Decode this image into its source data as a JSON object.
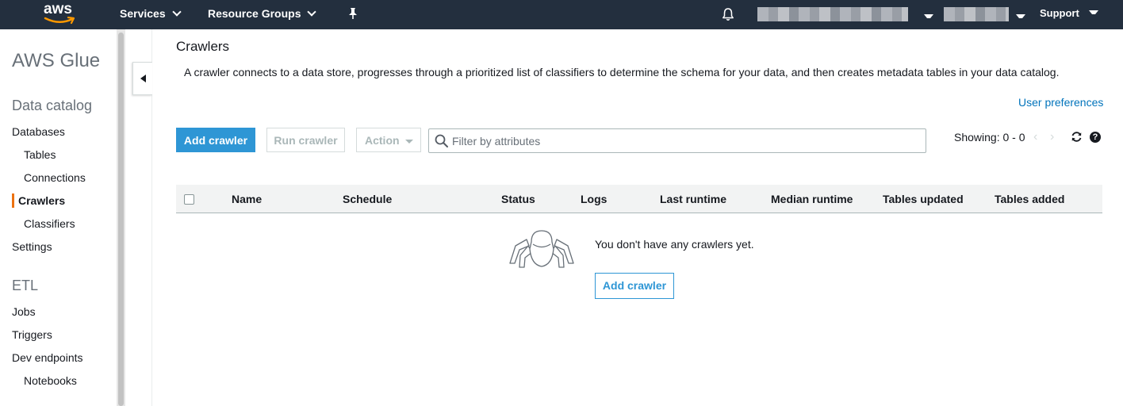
{
  "topnav": {
    "logo_text": "aws",
    "services_label": "Services",
    "resource_groups_label": "Resource Groups",
    "support_label": "Support"
  },
  "sidebar": {
    "service_title": "AWS Glue",
    "data_catalog_title": "Data catalog",
    "databases": "Databases",
    "tables": "Tables",
    "connections": "Connections",
    "crawlers": "Crawlers",
    "classifiers": "Classifiers",
    "settings": "Settings",
    "etl_title": "ETL",
    "jobs": "Jobs",
    "triggers": "Triggers",
    "dev_endpoints": "Dev endpoints",
    "notebooks": "Notebooks"
  },
  "main": {
    "title": "Crawlers",
    "description": "A crawler connects to a data store, progresses through a prioritized list of classifiers to determine the schema for your data, and then creates metadata tables in your data catalog.",
    "user_preferences": "User preferences",
    "add_crawler_label": "Add crawler",
    "run_crawler_label": "Run crawler",
    "action_label": "Action",
    "filter_placeholder": "Filter by attributes",
    "filter_value": "",
    "showing_text": "Showing: 0 - 0",
    "table_columns": [
      "Name",
      "Schedule",
      "Status",
      "Logs",
      "Last runtime",
      "Median runtime",
      "Tables updated",
      "Tables added"
    ],
    "empty_message": "You don't have any crawlers yet.",
    "empty_add_label": "Add crawler"
  },
  "colors": {
    "nav_bg": "#232f3e",
    "primary": "#2e96d5",
    "link": "#0073bb",
    "active_marker": "#ec7211"
  },
  "icons": {
    "logo": "aws-smile-icon",
    "pin": "pin-icon",
    "notifications": "bell-icon",
    "collapse": "caret-left-icon",
    "search": "search-icon",
    "prev": "chevron-left-icon",
    "next": "chevron-right-icon",
    "refresh": "refresh-icon",
    "help": "help-icon",
    "empty_state": "spider-icon"
  }
}
